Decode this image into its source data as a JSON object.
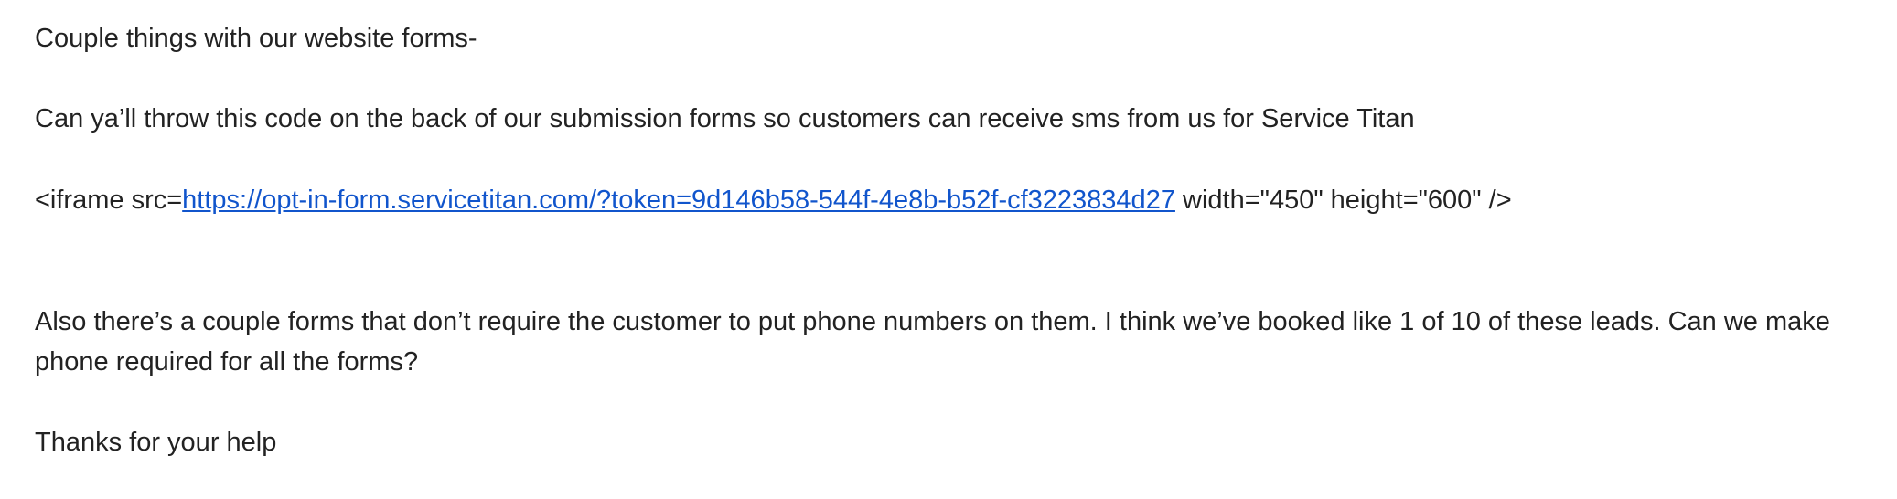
{
  "email": {
    "intro": "Couple things with our website forms-",
    "request": "Can ya’ll throw this code on the back of our submission forms so customers can receive sms from us for Service Titan",
    "code": {
      "prefix": "<iframe src=",
      "link_text": "https://opt-in-form.servicetitan.com/?token=9d146b58-544f-4e8b-b52f-cf3223834d27",
      "suffix": " width=\"450\" height=\"600\" />"
    },
    "phone_request": "Also there’s a couple forms that don’t require the customer to put phone numbers on them. I think we’ve booked like 1 of 10 of these leads. Can we make phone required for all the forms?",
    "signoff": "Thanks for your help"
  },
  "colors": {
    "text": "#222222",
    "link": "#1155cc",
    "background": "#ffffff"
  }
}
